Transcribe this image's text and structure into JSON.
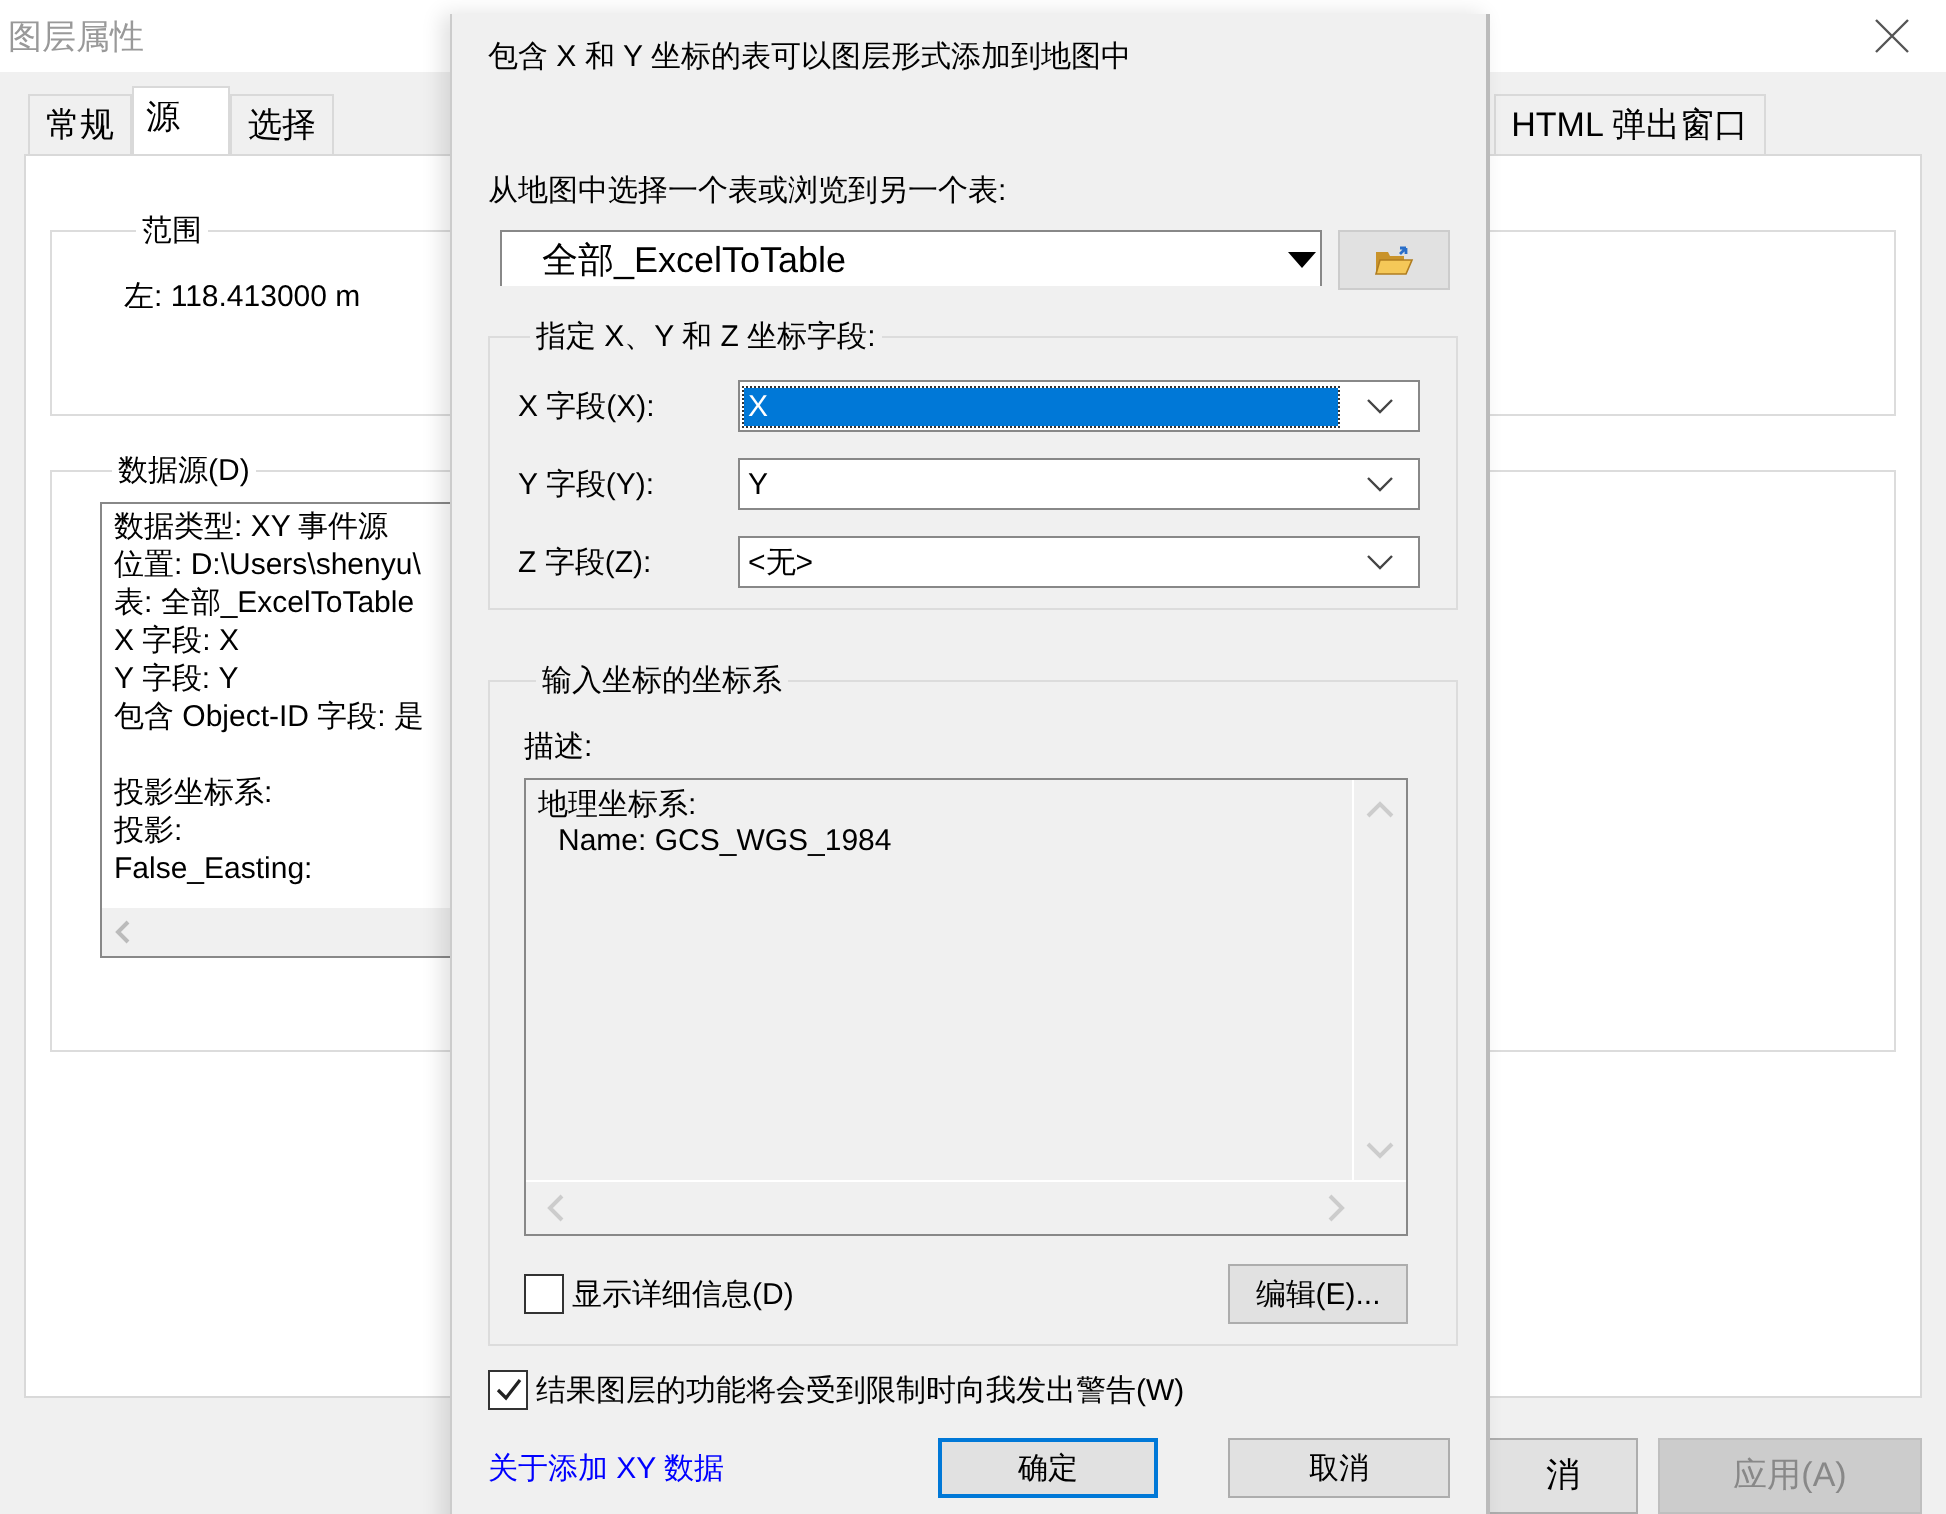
{
  "background_window": {
    "title": "图层属性",
    "tabs": [
      {
        "label": "常规",
        "selected": false
      },
      {
        "label": "源",
        "selected": true
      },
      {
        "label": "选择",
        "selected": false
      },
      {
        "label": "HTML 弹出窗口",
        "selected": false
      }
    ],
    "extent": {
      "title": "范围",
      "text": "左: 118.413000 m"
    },
    "data_source": {
      "title": "数据源(D)",
      "groups": [
        [
          "数据类型: XY 事件源",
          "位置: D:\\Users\\shenyu\\",
          "表: 全部_ExcelToTable",
          "X 字段: X",
          "Y 字段: Y",
          "包含 Object-ID 字段: 是"
        ],
        [
          "投影坐标系:",
          "投影:",
          "False_Easting:"
        ]
      ]
    },
    "buttons": [
      {
        "label": "消",
        "disabled": false
      },
      {
        "label": "应用(A)",
        "disabled": true
      }
    ]
  },
  "dialog": {
    "intro": "包含 X 和 Y 坐标的表可以图层形式添加到地图中",
    "table_prompt": "从地图中选择一个表或浏览到另一个表:",
    "table": {
      "value": "全部_ExcelToTable"
    },
    "fields_group": {
      "title": "指定 X、Y 和 Z 坐标字段:",
      "fields": [
        {
          "label": "X 字段(X):",
          "value": "X",
          "selected": true
        },
        {
          "label": "Y 字段(Y):",
          "value": "Y",
          "selected": false
        },
        {
          "label": "Z 字段(Z):",
          "value": "<无>",
          "selected": false
        }
      ]
    },
    "coordinate_system": {
      "title": "输入坐标的坐标系",
      "description_label": "描述:",
      "description_lines": [
        "地理坐标系:",
        "Name: GCS_WGS_1984"
      ],
      "show_details": {
        "label": "显示详细信息(D)",
        "checked": false
      },
      "edit_button": "编辑(E)..."
    },
    "warn": {
      "label": "结果图层的功能将会受到限制时向我发出警告(W)",
      "checked": true
    },
    "help_link": "关于添加 XY 数据",
    "buttons": [
      {
        "label": "确定",
        "focused": true
      },
      {
        "label": "取消",
        "focused": false
      }
    ]
  }
}
